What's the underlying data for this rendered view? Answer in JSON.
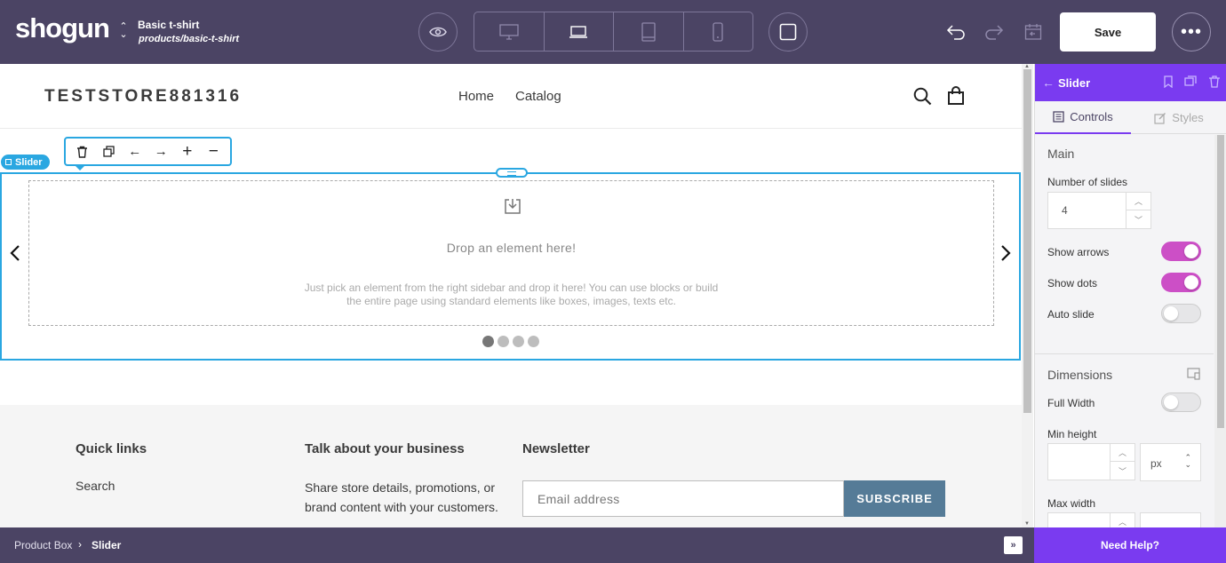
{
  "topbar": {
    "logo": "shogun",
    "page_title": "Basic t-shirt",
    "page_path": "products/basic-t-shirt",
    "page_switch_icon": "up-down-chevron-icon",
    "preview_icon": "eye-icon",
    "devices": [
      "desktop-icon",
      "laptop-icon",
      "tablet-icon",
      "mobile-icon"
    ],
    "active_device": "laptop",
    "frame_icon": "square-icon",
    "undo_icon": "undo-icon",
    "redo_icon": "redo-icon",
    "history_icon": "calendar-back-icon",
    "save_label": "Save",
    "more_icon": "more-horizontal-icon",
    "bg_color": "#4b4464"
  },
  "store": {
    "name": "TESTSTORE881316",
    "nav": [
      "Home",
      "Catalog"
    ]
  },
  "element_toolbar": {
    "tag_label": "Slider",
    "buttons": [
      "trash-icon",
      "duplicate-icon",
      "arrow-left-icon",
      "arrow-right-icon",
      "plus-icon",
      "minus-icon"
    ],
    "accent": "#2aa7e1"
  },
  "slider": {
    "drop_title": "Drop an element here!",
    "drop_desc_line1": "Just pick an element from the right sidebar and drop it here! You can use blocks or build",
    "drop_desc_line2": "the entire page using standard elements like boxes, images, texts etc.",
    "dots_count": 4,
    "active_dot": 0
  },
  "footer": {
    "quick_links_title": "Quick links",
    "quick_link_1": "Search",
    "business_title": "Talk about your business",
    "business_text": "Share store details, promotions, or brand content with your customers.",
    "newsletter_title": "Newsletter",
    "email_placeholder": "Email address",
    "subscribe_label": "SUBSCRIBE"
  },
  "panel": {
    "title": "Slider",
    "tab_controls": "Controls",
    "tab_styles": "Styles",
    "accent": "#7a3bf0",
    "main_section": "Main",
    "num_slides_label": "Number of slides",
    "num_slides_value": "4",
    "show_arrows_label": "Show arrows",
    "show_arrows": true,
    "show_dots_label": "Show dots",
    "show_dots": true,
    "auto_slide_label": "Auto slide",
    "auto_slide": false,
    "dimensions_section": "Dimensions",
    "full_width_label": "Full Width",
    "full_width": false,
    "min_height_label": "Min height",
    "min_height_unit": "px",
    "max_width_label": "Max width",
    "toggle_on_color": "#cc4fc6"
  },
  "bottombar": {
    "crumb_1": "Product Box",
    "crumb_2": "Slider",
    "help_label": "Need Help?"
  }
}
